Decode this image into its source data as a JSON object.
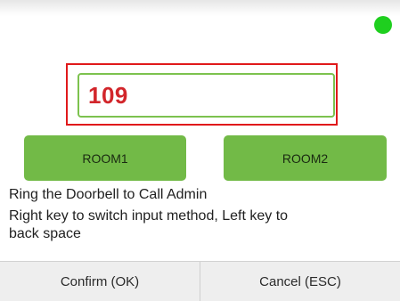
{
  "status": {
    "indicator_icon": "online-status-dot-icon",
    "indicator_color": "#1fcf1f"
  },
  "input": {
    "value": "109",
    "value_color": "#d2262b",
    "border_color": "#7cc24e",
    "highlight_color": "#e0191b"
  },
  "rooms": {
    "room1_label": "ROOM1",
    "room2_label": "ROOM2",
    "button_color": "#72ba47"
  },
  "instructions": {
    "line1": "Ring the Doorbell to Call Admin",
    "line2": "Right key to switch input method, Left key to",
    "line3": "back space"
  },
  "footer": {
    "confirm_label": "Confirm (OK)",
    "cancel_label": "Cancel (ESC)"
  }
}
